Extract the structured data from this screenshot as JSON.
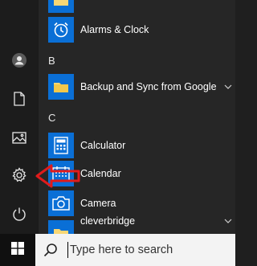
{
  "sections": {
    "b": "B",
    "c": "C"
  },
  "apps": {
    "alarms": {
      "label": "Alarms & Clock",
      "icon": "alarm-clock-icon"
    },
    "backup": {
      "label": "Backup and Sync from Google",
      "icon": "folder-icon"
    },
    "calculator": {
      "label": "Calculator",
      "icon": "calculator-icon"
    },
    "calendar": {
      "label": "Calendar",
      "icon": "calendar-icon"
    },
    "camera": {
      "label": "Camera",
      "icon": "camera-icon"
    },
    "cleverbridge": {
      "label": "cleverbridge",
      "icon": "folder-icon"
    }
  },
  "search": {
    "placeholder": "Type here to search"
  },
  "colors": {
    "tile": "#0a6fd6",
    "folder": "#f8d775",
    "annotation_arrow": "#e01b1b"
  }
}
